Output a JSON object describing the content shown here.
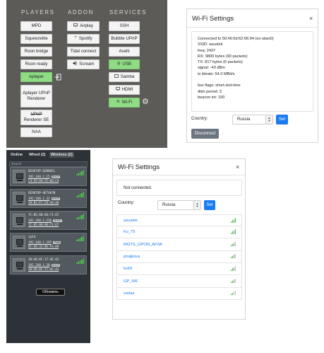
{
  "addon_panel": {
    "headers": {
      "players": "PLAYERS",
      "addon": "ADDON",
      "services": "SERVICES"
    },
    "players": [
      "MPD",
      "Squeezelite",
      "Roon bridge",
      "Roon ready",
      "Aplayer",
      "Aplayer UPnP Renderer",
      "UPnP Renderer SE",
      "NAA"
    ],
    "active_player": "Aplayer",
    "addon": [
      {
        "label": "Airplay",
        "icon": "monitor-icon"
      },
      {
        "label": "Spotify",
        "icon": "spotify-icon"
      },
      {
        "label": "Tidal connect",
        "icon": ""
      },
      {
        "label": "Scream",
        "icon": "speaker-icon"
      }
    ],
    "services": [
      {
        "label": "SSH",
        "icon": "",
        "active": false
      },
      {
        "label": "Bubble UPnP",
        "icon": "",
        "active": false
      },
      {
        "label": "Avahi",
        "icon": "",
        "active": false
      },
      {
        "label": "USB",
        "icon": "usb-icon",
        "active": true
      },
      {
        "label": "Samba",
        "icon": "folder-icon",
        "active": false
      },
      {
        "label": "HDMI",
        "icon": "monitor-icon",
        "active": false
      },
      {
        "label": "Wi-Fi",
        "icon": "wifi-icon",
        "active": true
      }
    ],
    "colors": {
      "background": "#5c5b58",
      "active": "#8fdc85"
    }
  },
  "wifi_connected": {
    "title": "Wi-Fi Settings",
    "close": "×",
    "info": [
      "Connected to 50:46:5d:62:06:94 (on wlan0)",
      "SSID: asustek",
      "freq: 2437",
      "RX: 9800 bytes (90 packets)",
      "TX: 817 bytes (6 packets)",
      "signal: -43 dBm",
      "tx bitrate: 54.0 MBit/s",
      "",
      "bss flags: short-slot-time",
      "dtim period: 3",
      "beacon int: 100"
    ],
    "country_label": "Country:",
    "country_value": "Russia",
    "set_label": "Set",
    "disconnect_label": "Disconnect"
  },
  "network_list": {
    "tabs": [
      "Online",
      "Wired (2)",
      "Wireless (2)"
    ],
    "active_tab": "Wireless (2)",
    "search_placeholder": "Search",
    "devices": [
      {
        "name": "DESKTOP-Q2BDOEL",
        "ip": "192.168.1.15",
        "type": "DHCP",
        "mac": "C4:E9:84:CE:8D:C9",
        "bars": 4
      },
      {
        "name": "DESKTOP-9ETG07N",
        "ip": "192.168.1.32",
        "type": "DHCP",
        "mac": "58:B3:FC:C0:49:40",
        "bars": 4
      },
      {
        "name": "7C:05:AB:AD:71:6T",
        "ip": "192.168.1.236",
        "type": "DHCP",
        "mac": "7C:05:AB:AD:71:6T",
        "bars": 4
      },
      {
        "name": "cp14",
        "ip": "192.168.1.197",
        "type": "Static",
        "mac": "DC:A6:32:86:FA:09",
        "bars": 4
      },
      {
        "name": "20:A6:0C:17:4E:42",
        "ip": "192.168.1.30",
        "type": "DHCP",
        "mac": "20:A6:0C:17:4E:42",
        "bars": 4
      }
    ],
    "refresh_label": "Обновить"
  },
  "wifi_disconnected": {
    "title": "Wi-Fi Settings",
    "close": "×",
    "status": "Not connected.",
    "country_label": "Country:",
    "country_value": "Russia",
    "set_label": "Set",
    "networks": [
      {
        "ssid": "asustek",
        "bars": 4
      },
      {
        "ssid": "Kv_75",
        "bars": 4
      },
      {
        "ssid": "MGTS_GPON_AF3A",
        "bars": 3
      },
      {
        "ssid": "pirajkova",
        "bars": 3
      },
      {
        "ssid": "kv69",
        "bars": 3
      },
      {
        "ssid": "GP_WF",
        "bars": 3
      },
      {
        "ssid": "vodax",
        "bars": 2
      }
    ]
  }
}
